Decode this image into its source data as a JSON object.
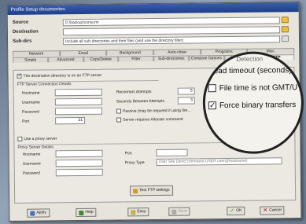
{
  "window": {
    "title": "Profile Setup documenten"
  },
  "source": {
    "label": "Source",
    "value": "D:\\backup\\consum\\"
  },
  "destination": {
    "label": "Destination",
    "value": ""
  },
  "subdirs": {
    "label": "Sub-dirs",
    "value": "Include all sub-directories and their files (and use the directory filter)"
  },
  "tabs_row1": [
    "Network",
    "Email",
    "Background",
    "Auto-close",
    "Programs",
    "Misc."
  ],
  "tabs_row2": [
    "Simple",
    "Advanced",
    "Copy/Delete",
    "Filter",
    "Sub-directories",
    "Compare Options",
    "Compression",
    "FTP"
  ],
  "ftp": {
    "dest_on_ftp_label": "The destination directory is on an FTP server",
    "conn_group": "FTP Server Connection Details",
    "hostname": "Hostname",
    "username": "Username",
    "password": "Password",
    "port": "Port",
    "port_value": "21",
    "reconnect": "Reconnect Attempts",
    "reconnect_value": "5",
    "seconds_between": "Seconds Between Attempts",
    "seconds_value": "3",
    "passive": "Passive (may be required if using fire...",
    "server_details": "Server requires Allocate command",
    "use_proxy": "Use a proxy server",
    "proxy_group": "Proxy Server Details",
    "p_hostname": "Hostname",
    "p_username": "Username",
    "p_password": "Password",
    "p_port": "Port",
    "proxy_type": "Proxy Type",
    "proxy_type_value": "User Site (send command USER user@hostname)",
    "test_button": "Test FTP settings"
  },
  "zoom": {
    "read_timeout": "Read timeout (seconds)",
    "file_time": "File time is not GMT/U",
    "force_binary": "Force binary transfers",
    "top_cut": "Detection"
  },
  "buttons": {
    "apply": "Apply",
    "help": "Help",
    "easy": "Easy",
    "save": "Save",
    "ok": "OK",
    "cancel": "Cancel"
  }
}
